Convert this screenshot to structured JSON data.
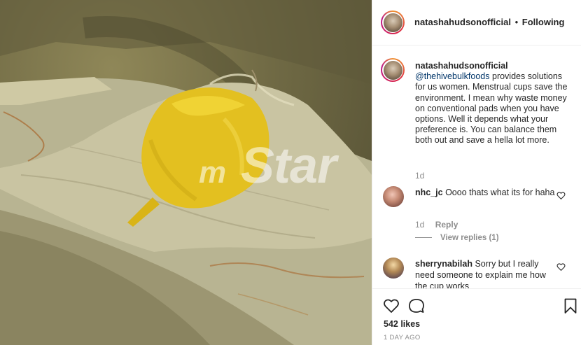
{
  "post": {
    "username": "natashahudsonofficial",
    "separator": "•",
    "follow_status": "Following"
  },
  "watermark": {
    "prefix": "m",
    "brand": "Star"
  },
  "caption": {
    "username": "natashahudsonofficial",
    "mention": "@thehivebulkfoods",
    "text": " provides solutions for us women. Menstrual cups save the environment. I mean why waste money on conventional pads when you have options. Well it depends what your preference is. You can balance them both out and save a hella lot more.",
    "time": "1d"
  },
  "comments": [
    {
      "username": "nhc_jc",
      "text": " Oooo thats what its for haha",
      "time": "1d",
      "reply_label": "Reply",
      "view_replies": "View replies (1)"
    },
    {
      "username": "sherrynabilah",
      "text": " Sorry but I really need someone to explain me how the cup works"
    }
  ],
  "actions": {
    "likes": "542 likes",
    "date": "1 DAY AGO"
  },
  "icons": {
    "like": "heart-icon",
    "comment": "comment-bubble-icon",
    "save": "bookmark-icon"
  }
}
